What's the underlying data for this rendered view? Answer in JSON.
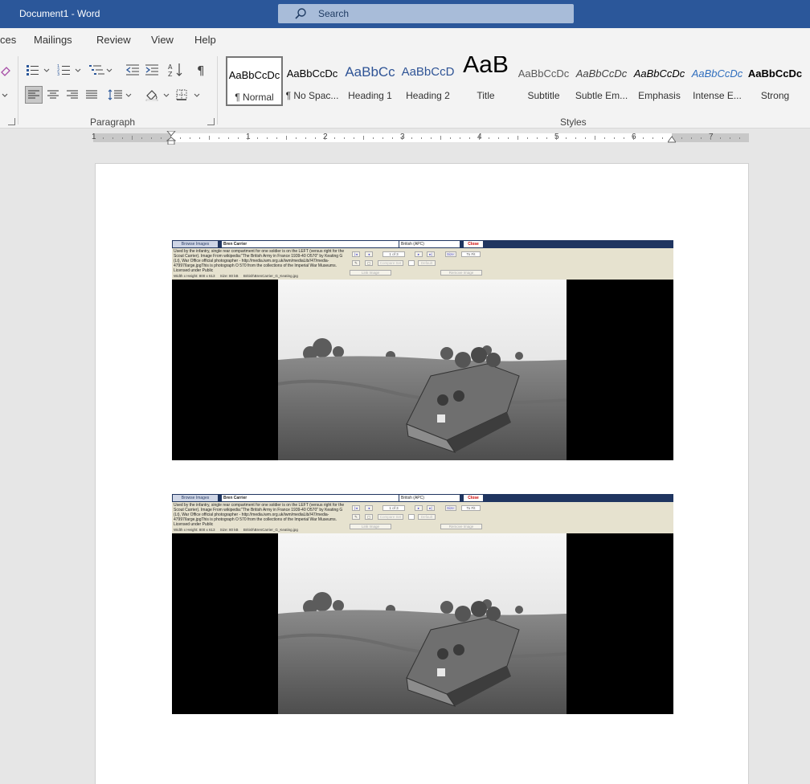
{
  "window": {
    "title": "Document1  -  Word"
  },
  "search": {
    "label": "Search"
  },
  "tabs": [
    "ces",
    "Mailings",
    "Review",
    "View",
    "Help"
  ],
  "groups": {
    "paragraph": "Paragraph",
    "styles": "Styles"
  },
  "styles": [
    {
      "preview": "AaBbCcDc",
      "name": "¶ Normal"
    },
    {
      "preview": "AaBbCcDc",
      "name": "¶ No Spac..."
    },
    {
      "preview": "AaBbCc",
      "name": "Heading 1"
    },
    {
      "preview": "AaBbCcD",
      "name": "Heading 2"
    },
    {
      "preview": "AaB",
      "name": "Title"
    },
    {
      "preview": "AaBbCcDc",
      "name": "Subtitle"
    },
    {
      "preview": "AaBbCcDc",
      "name": "Subtle Em..."
    },
    {
      "preview": "AaBbCcDc",
      "name": "Emphasis"
    },
    {
      "preview": "AaBbCcDc",
      "name": "Intense E..."
    },
    {
      "preview": "AaBbCcDc",
      "name": "Strong"
    }
  ],
  "ruler": {
    "numbers": [
      "1",
      "1",
      "2",
      "3",
      "4",
      "5",
      "6",
      "7"
    ]
  },
  "embedded_app": {
    "browse_label": "Browse Images",
    "item_name": "Bren Carrier",
    "category": "British (APC)",
    "close_label": "Close",
    "description": "Used by the infantry, single rear compartment for one soldier is on the LEFT (versus right for the Scout Carrier). Image From wikipedia:\"The British Army in France 1939-40 O570\" by Keating G (Lt), War Office official photographer - http://media.iwm.org.uk/iwm/mediaLib//47/media-47997/large.jpgThis is photograph O 570 from the collections of the Imperial War Museums. Licensed under Public",
    "dimensions": "Width x Height: 800 x 613",
    "size": "Size: 80 kB",
    "filename": "British\\BrenCarrier_G_Keating.jpg",
    "counter": "1 of 3",
    "size_label": "Size:",
    "fit_label": "To Fit",
    "link_image": "Link Image",
    "remove_image": "Remove Image",
    "compare_label": "Compare Set",
    "default_label": "Default"
  },
  "colors": {
    "title_bar": "#2b579a",
    "ribbon": "#f3f3f3",
    "canvas": "#e6e6e6",
    "intense_emphasis": "#2f6ebd"
  }
}
